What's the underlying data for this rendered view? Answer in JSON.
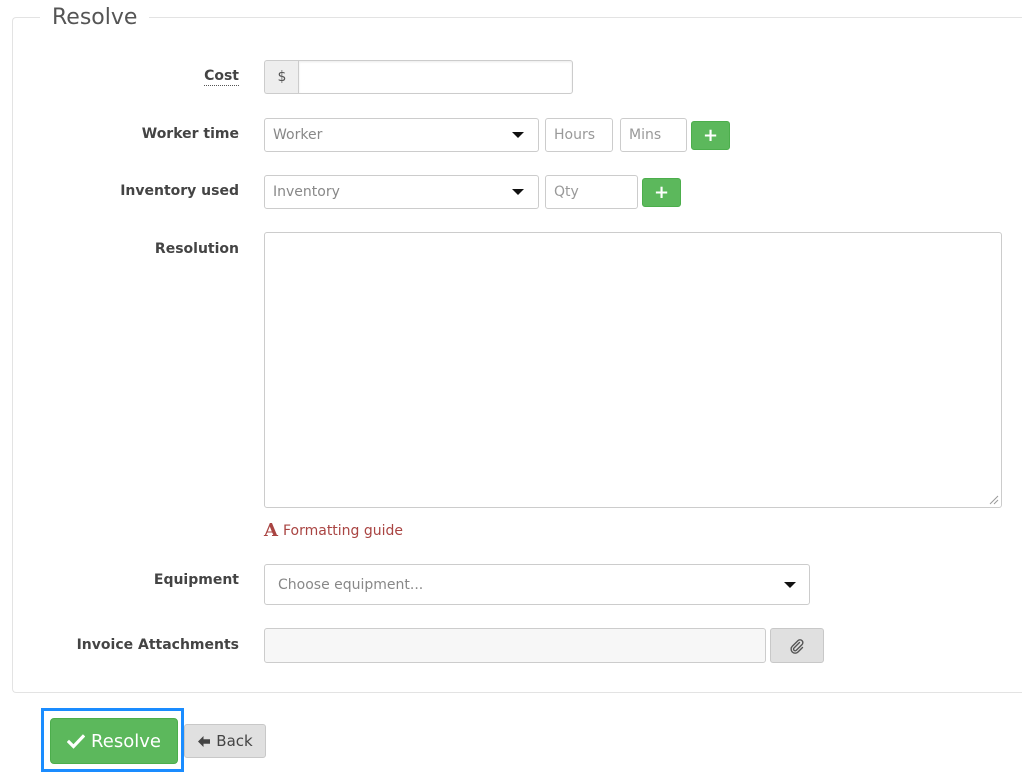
{
  "section": {
    "legend": "Resolve"
  },
  "cost": {
    "label": "Cost",
    "currency": "$",
    "value": ""
  },
  "worker_time": {
    "label": "Worker time",
    "worker_placeholder": "Worker",
    "hours_placeholder": "Hours",
    "mins_placeholder": "Mins",
    "add_label": "+"
  },
  "inventory": {
    "label": "Inventory used",
    "inventory_placeholder": "Inventory",
    "qty_placeholder": "Qty",
    "add_label": "+"
  },
  "resolution": {
    "label": "Resolution",
    "value": ""
  },
  "formatting": {
    "icon": "A",
    "label": "Formatting guide"
  },
  "equipment": {
    "label": "Equipment",
    "placeholder": "Choose equipment..."
  },
  "attachments": {
    "label": "Invoice Attachments",
    "icon": "paperclip-icon"
  },
  "actions": {
    "resolve_label": "Resolve",
    "back_label": "Back"
  },
  "colors": {
    "success": "#5cb85c",
    "danger_text": "#a94442",
    "focus_highlight": "#1a8cff",
    "default_button": "#e0e0e0"
  }
}
